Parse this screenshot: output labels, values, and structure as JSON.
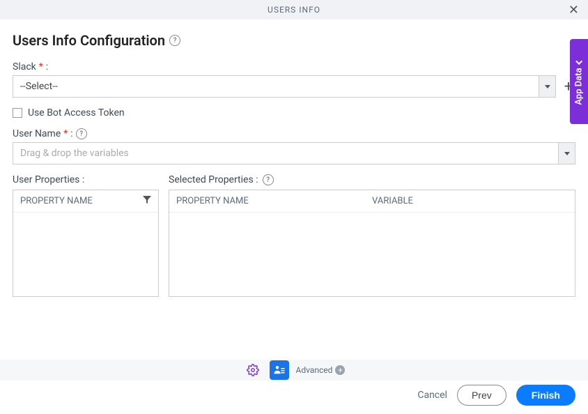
{
  "header": {
    "title": "USERS INFO"
  },
  "page": {
    "title": "Users Info Configuration"
  },
  "slack": {
    "label": "Slack",
    "value": "--Select--"
  },
  "botToken": {
    "label": "Use Bot Access Token"
  },
  "userName": {
    "label": "User Name",
    "placeholder": "Drag & drop the variables"
  },
  "userProps": {
    "label": "User Properties :",
    "header": "PROPERTY NAME"
  },
  "selectedProps": {
    "label": "Selected Properties :",
    "col1": "PROPERTY NAME",
    "col2": "VARIABLE"
  },
  "advanced": {
    "label": "Advanced"
  },
  "buttons": {
    "cancel": "Cancel",
    "prev": "Prev",
    "finish": "Finish"
  },
  "sideTab": {
    "label": "App Data"
  }
}
